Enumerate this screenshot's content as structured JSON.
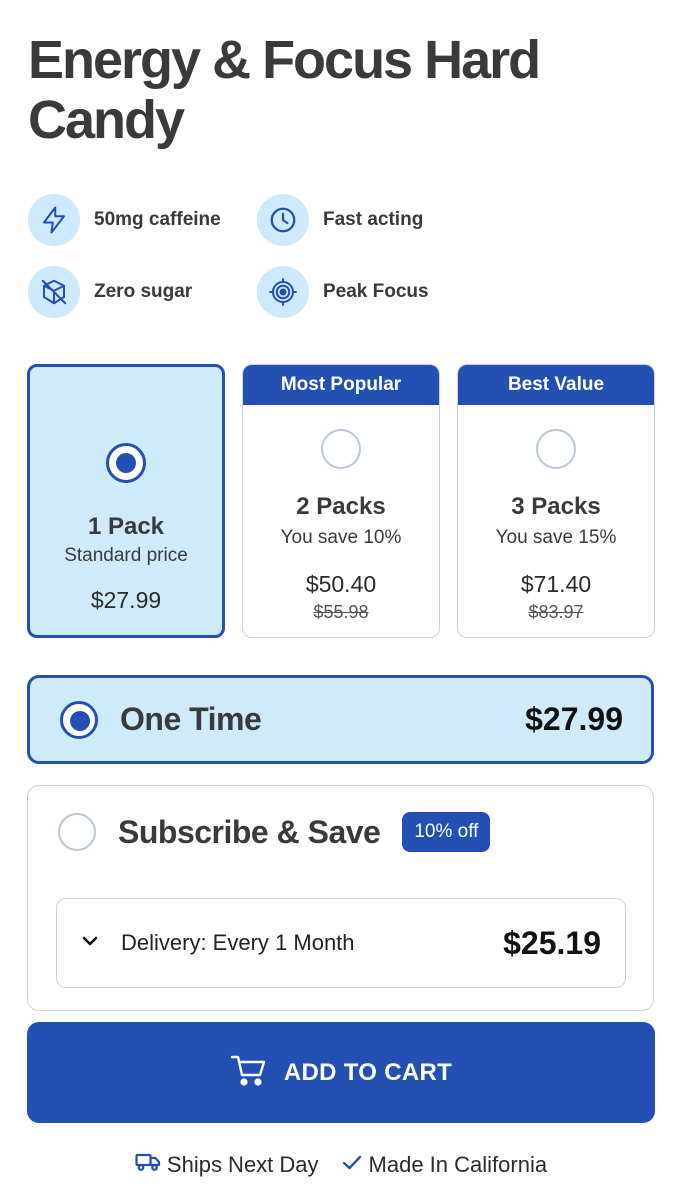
{
  "product": {
    "title": "Energy & Focus Hard Candy"
  },
  "features": [
    {
      "label": "50mg caffeine",
      "icon": "lightning-icon"
    },
    {
      "label": "Fast acting",
      "icon": "clock-icon"
    },
    {
      "label": "Zero sugar",
      "icon": "no-sugar-cube-icon"
    },
    {
      "label": "Peak Focus",
      "icon": "target-icon"
    }
  ],
  "packs": [
    {
      "tag": "",
      "name": "1 Pack",
      "subtitle": "Standard price",
      "price": "$27.99",
      "old_price": "",
      "selected": true
    },
    {
      "tag": "Most Popular",
      "name": "2 Packs",
      "subtitle": "You save 10%",
      "price": "$50.40",
      "old_price": "$55.98",
      "selected": false
    },
    {
      "tag": "Best Value",
      "name": "3 Packs",
      "subtitle": "You save 15%",
      "price": "$71.40",
      "old_price": "$83.97",
      "selected": false
    }
  ],
  "purchase_options": {
    "one_time": {
      "label": "One Time",
      "price": "$27.99",
      "selected": true
    },
    "subscribe": {
      "label": "Subscribe & Save",
      "badge": "10% off",
      "delivery_label": "Delivery: Every 1 Month",
      "price": "$25.19",
      "selected": false
    }
  },
  "cart": {
    "label": "ADD TO CART"
  },
  "footer": {
    "shipping": "Ships Next Day",
    "origin": "Made In California"
  },
  "colors": {
    "accent": "#2350b2",
    "selected_bg": "#cfeafb",
    "icon_bg": "#cde9fb",
    "border": "#c9d3e3"
  }
}
